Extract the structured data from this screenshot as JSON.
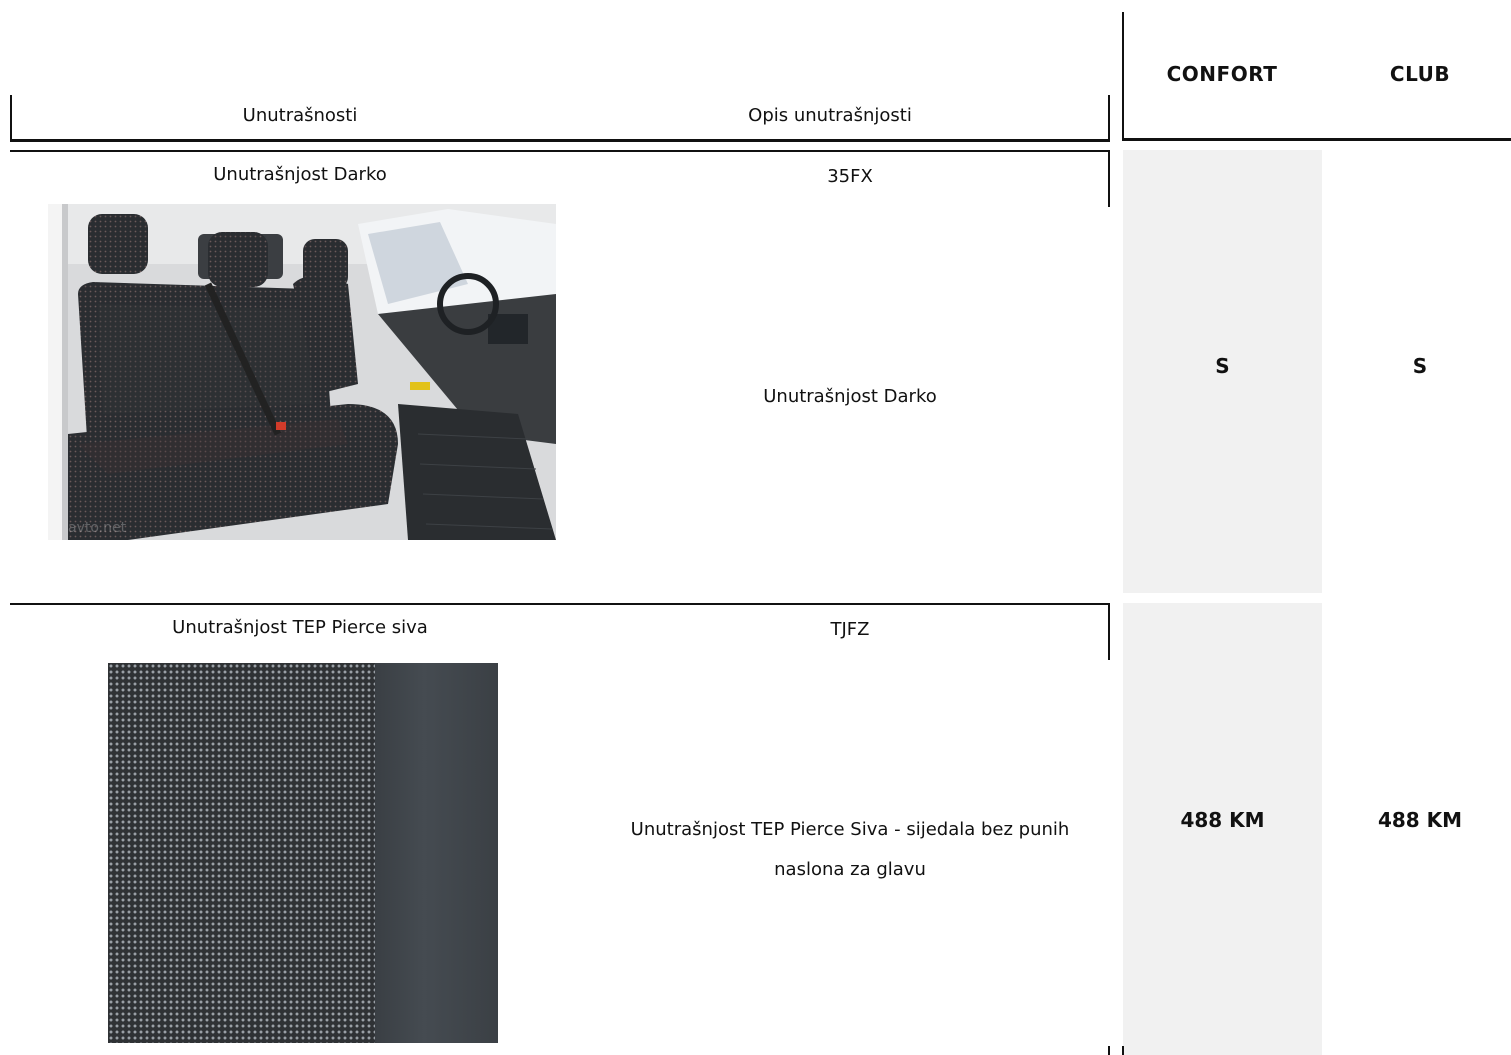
{
  "header": {
    "col_interiors": "Unutrašnosti",
    "col_description": "Opis unutrašnjosti",
    "trims": [
      "CONFORT",
      "CLUB"
    ]
  },
  "rows": [
    {
      "name": "Unutrašnjost Darko",
      "code": "35FX",
      "description": "Unutrašnjost Darko",
      "confort": "S",
      "club": "S",
      "image_icon": "van-interior-seats-photo"
    },
    {
      "name": "Unutrašnjost TEP Pierce siva",
      "code": "TJFZ",
      "description": "Unutrašnjost TEP Pierce Siva - sijedala bez punih naslona za glavu",
      "confort": "488 KM",
      "club": "488 KM",
      "image_icon": "grey-fabric-swatch"
    }
  ],
  "colors": {
    "line": "#111111",
    "grey_column": "#f1f1f1"
  }
}
